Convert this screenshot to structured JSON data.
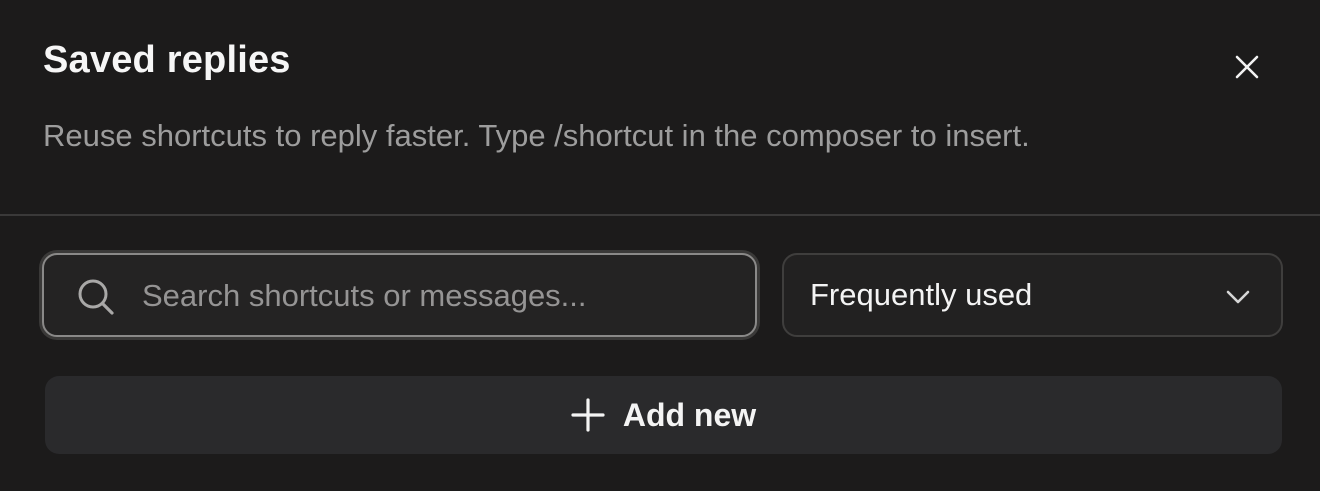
{
  "header": {
    "title": "Saved replies",
    "subtitle": "Reuse shortcuts to reply faster. Type /shortcut in the composer to insert.",
    "close_icon": "close-icon"
  },
  "search": {
    "placeholder": "Search shortcuts or messages...",
    "value": "",
    "icon": "search-icon"
  },
  "sort": {
    "selected": "Frequently used",
    "icon": "chevron-down-icon"
  },
  "actions": {
    "add_label": "Add new",
    "add_icon": "plus-icon"
  },
  "colors": {
    "background": "#1c1b1b",
    "text_primary": "#f4f4f4",
    "text_muted": "#9d9d9d",
    "button_bg": "#2a2a2c"
  }
}
